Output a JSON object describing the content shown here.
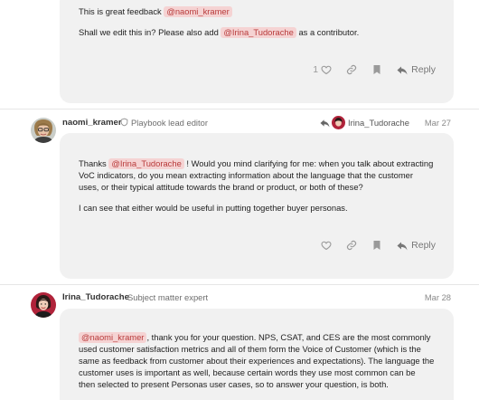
{
  "post1": {
    "line1_prefix": "This is great feedback",
    "line1_mention": "@naomi_kramer",
    "line2_prefix": "Shall we edit this in? Please also add",
    "line2_mention": "@Irina_Tudorache",
    "line2_suffix": "as a contributor.",
    "like_count": "1",
    "reply_label": "Reply"
  },
  "post2": {
    "username": "naomi_kramer",
    "user_title": "Playbook lead editor",
    "reply_to": "Irina_Tudorache",
    "date": "Mar 27",
    "para1_prefix": "Thanks",
    "para1_mention": "@Irina_Tudorache",
    "para1_l1": "! Would you mind clarifying for me: when you talk about extracting",
    "para1_l2": "VoC indicators, do you mean extracting information about the language that the customer",
    "para1_l3": "uses, or their typical attitude towards the brand or product, or both of these?",
    "para2": "I can see that either would be useful in putting together buyer personas.",
    "reply_label": "Reply"
  },
  "post3": {
    "username": "Irina_Tudorache",
    "user_title": "Subject matter expert",
    "date": "Mar 28",
    "mention": "@naomi_kramer",
    "l1": ", thank you for your question. NPS, CSAT, and CES are the most commonly",
    "l2": "used customer satisfaction metrics and all of them form the Voice of Customer (which is the",
    "l3": "same as feedback from customer about their experiences and expectations). The language the",
    "l4": "customer uses is important as well, because certain words they use most common can be",
    "l5": "then selected to present Personas user cases, so to answer your question, is both."
  },
  "icons": {
    "like": "heart-icon",
    "link": "link-icon",
    "bookmark": "bookmark-icon",
    "reply": "reply-arrow-icon",
    "moderator": "shield-icon",
    "reply_to": "reply-to-arrow-icon"
  },
  "colors": {
    "mention_bg": "#f5d3d3",
    "mention_text": "#b83b3b",
    "bubble_bg": "#f1f1f1"
  }
}
